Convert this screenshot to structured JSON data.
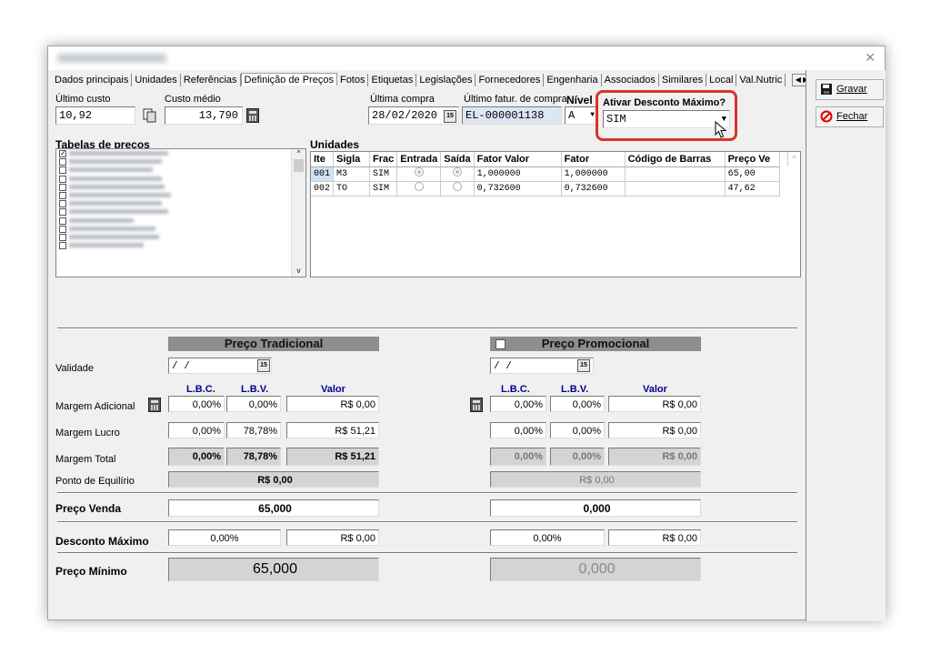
{
  "window": {
    "close_label": "✕"
  },
  "tabs": [
    "Dados principais",
    "Unidades",
    "Referências",
    "Definição de Preços",
    "Fotos",
    "Etiquetas",
    "Legislações",
    "Fornecedores",
    "Engenharia",
    "Associados",
    "Similares",
    "Local",
    "Val.Nutric"
  ],
  "tab_arrows": "◀ ▶",
  "buttons": {
    "gravar": "Gravar",
    "fechar": "Fechar"
  },
  "header": {
    "ultimo_custo_label": "Último custo",
    "ultimo_custo_value": "10,92",
    "custo_medio_label": "Custo médio",
    "custo_medio_value": "13,790",
    "ultima_compra_label": "Última compra",
    "ultima_compra_value": "28/02/2020",
    "ultimo_fatur_label": "Último fatur. de compra",
    "ultimo_fatur_value": "EL-000001138",
    "nivel_label": "Nível",
    "nivel_value": "A",
    "desconto_label": "Ativar Desconto Máximo?",
    "desconto_value": "SIM"
  },
  "tabelas": {
    "label": "Tabelas de preços"
  },
  "unidades": {
    "label": "Unidades",
    "columns": [
      "Ite",
      "Sigla",
      "Frac",
      "Entrada",
      "Saída",
      "Fator Valor",
      "Fator",
      "Código de Barras",
      "Preço Ve"
    ],
    "rows": [
      {
        "ite": "001",
        "sigla": "M3",
        "frac": "SIM",
        "entrada": true,
        "saida": true,
        "fator_valor": "1,000000",
        "fator": "1,000000",
        "barras": "",
        "preco": "65,00"
      },
      {
        "ite": "002",
        "sigla": "TO",
        "frac": "SIM",
        "entrada": false,
        "saida": false,
        "fator_valor": "0,732600",
        "fator": "0,732600",
        "barras": "",
        "preco": "47,62"
      }
    ]
  },
  "precos": {
    "tradicional_title": "Preço Tradicional",
    "promocional_title": "Preço Promocional",
    "validade_label": "Validade",
    "validade_value": " /  /",
    "lbc": "L.B.C.",
    "lbv": "L.B.V.",
    "valor": "Valor",
    "margem_adicional_label": "Margem Adicional",
    "margem_lucro_label": "Margem Lucro",
    "margem_total_label": "Margem Total",
    "ponto_label": "Ponto de Equilírio",
    "preco_venda_label": "Preço Venda",
    "desconto_maximo_label": "Desconto Máximo",
    "preco_minimo_label": "Preço Mínimo",
    "trad": {
      "ma_lbc": "0,00%",
      "ma_lbv": "0,00%",
      "ma_valor": "R$ 0,00",
      "ml_lbc": "0,00%",
      "ml_lbv": "78,78%",
      "ml_valor": "R$ 51,21",
      "mt_lbc": "0,00%",
      "mt_lbv": "78,78%",
      "mt_valor": "R$ 51,21",
      "ponto": "R$ 0,00",
      "venda": "65,000",
      "dm_pct": "0,00%",
      "dm_valor": "R$ 0,00",
      "minimo": "65,000"
    },
    "promo": {
      "ma_lbc": "0,00%",
      "ma_lbv": "0,00%",
      "ma_valor": "R$ 0,00",
      "ml_lbc": "0,00%",
      "ml_lbv": "0,00%",
      "ml_valor": "R$ 0,00",
      "mt_lbc": "0,00%",
      "mt_lbv": "0,00%",
      "mt_valor": "R$ 0,00",
      "ponto": "R$ 0,00",
      "venda": "0,000",
      "dm_pct": "0,00%",
      "dm_valor": "R$ 0,00",
      "minimo": "0,000"
    }
  },
  "colors": {
    "highlight": "#d9332b",
    "header_bar": "#8e8e8e"
  }
}
